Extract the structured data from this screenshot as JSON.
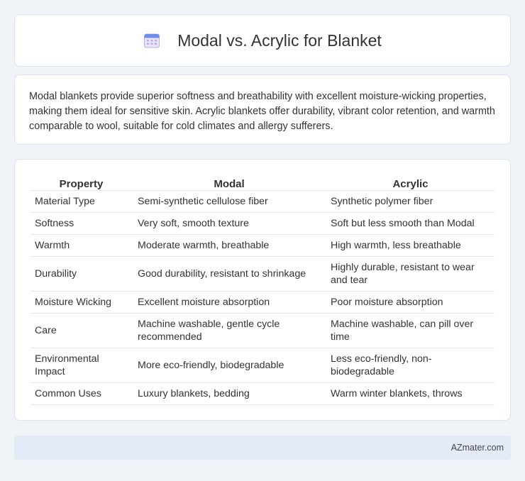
{
  "header": {
    "title": "Modal vs. Acrylic for Blanket",
    "icon": "calendar-icon"
  },
  "summary": {
    "text": "Modal blankets provide superior softness and breathability with excellent moisture-wicking properties, making them ideal for sensitive skin. Acrylic blankets offer durability, vibrant color retention, and warmth comparable to wool, suitable for cold climates and allergy sufferers."
  },
  "table": {
    "headers": [
      "Property",
      "Modal",
      "Acrylic"
    ],
    "rows": [
      [
        "Material Type",
        "Semi-synthetic cellulose fiber",
        "Synthetic polymer fiber"
      ],
      [
        "Softness",
        "Very soft, smooth texture",
        "Soft but less smooth than Modal"
      ],
      [
        "Warmth",
        "Moderate warmth, breathable",
        "High warmth, less breathable"
      ],
      [
        "Durability",
        "Good durability, resistant to shrinkage",
        "Highly durable, resistant to wear and tear"
      ],
      [
        "Moisture Wicking",
        "Excellent moisture absorption",
        "Poor moisture absorption"
      ],
      [
        "Care",
        "Machine washable, gentle cycle recommended",
        "Machine washable, can pill over time"
      ],
      [
        "Environmental Impact",
        "More eco-friendly, biodegradable",
        "Less eco-friendly, non-biodegradable"
      ],
      [
        "Common Uses",
        "Luxury blankets, bedding",
        "Warm winter blankets, throws"
      ]
    ]
  },
  "footer": {
    "text": "AZmater.com"
  },
  "colors": {
    "background": "#f0f3f8",
    "card": "#ffffff",
    "footer_bg": "#e4ebf6",
    "icon_accent": "#7b8fe0"
  }
}
